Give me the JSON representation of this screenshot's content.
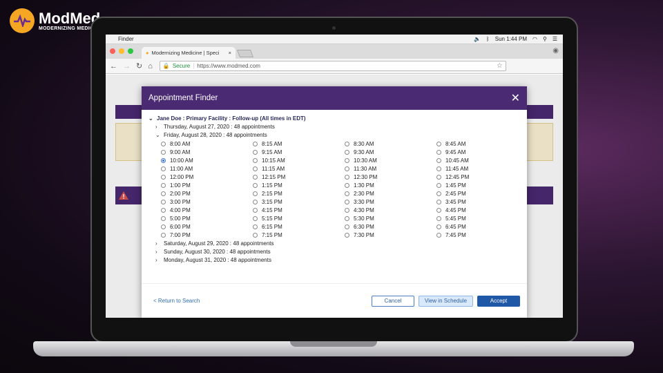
{
  "brand": {
    "name": "ModMed",
    "tagline": "MODERNIZING MEDICINE"
  },
  "menubar": {
    "app": "Finder",
    "clock": "Sun 1:44 PM"
  },
  "browser": {
    "tab_title": "Modernizing Medicine | Speci",
    "tab_close": "×",
    "secure_label": "Secure",
    "url": "https://www.modmed.com"
  },
  "modal": {
    "title": "Appointment Finder",
    "close": "✕",
    "patient_line": "Jane Doe : Primary Facility : Follow-up (All times in EDT)",
    "days_before": [
      {
        "label": "Thursday, August 27, 2020 : 48 appointments",
        "expanded": false
      }
    ],
    "expanded_day": {
      "label": "Friday, August 28, 2020 : 48 appointments",
      "expanded": true
    },
    "slots": [
      "8:00 AM",
      "8:15 AM",
      "8:30 AM",
      "8:45 AM",
      "9:00 AM",
      "9:15 AM",
      "9:30 AM",
      "9:45 AM",
      "10:00 AM",
      "10:15 AM",
      "10:30 AM",
      "10:45 AM",
      "11:00 AM",
      "11:15 AM",
      "11:30 AM",
      "11:45 AM",
      "12:00 PM",
      "12:15 PM",
      "12:30 PM",
      "12:45 PM",
      "1:00 PM",
      "1:15 PM",
      "1:30 PM",
      "1:45 PM",
      "2:00 PM",
      "2:15 PM",
      "2:30 PM",
      "2:45 PM",
      "3:00 PM",
      "3:15 PM",
      "3:30 PM",
      "3:45 PM",
      "4:00 PM",
      "4:15 PM",
      "4:30 PM",
      "4:45 PM",
      "5:00 PM",
      "5:15 PM",
      "5:30 PM",
      "5:45 PM",
      "6:00 PM",
      "6:15 PM",
      "6:30 PM",
      "6:45 PM",
      "7:00 PM",
      "7:15 PM",
      "7:30 PM",
      "7:45 PM"
    ],
    "selected_slot": "10:00 AM",
    "days_after": [
      {
        "label": "Saturday, August 29, 2020 : 48 appointments",
        "expanded": false
      },
      {
        "label": "Sunday, August 30, 2020 : 48 appointments",
        "expanded": false
      },
      {
        "label": "Monday, August 31, 2020 : 48 appointments",
        "expanded": false
      }
    ],
    "footer": {
      "back": "< Return to Search",
      "cancel": "Cancel",
      "view": "View in Schedule",
      "accept": "Accept"
    }
  },
  "colors": {
    "modal_header": "#4b2a74",
    "accept": "#1f58a6",
    "link": "#2f6db5"
  }
}
